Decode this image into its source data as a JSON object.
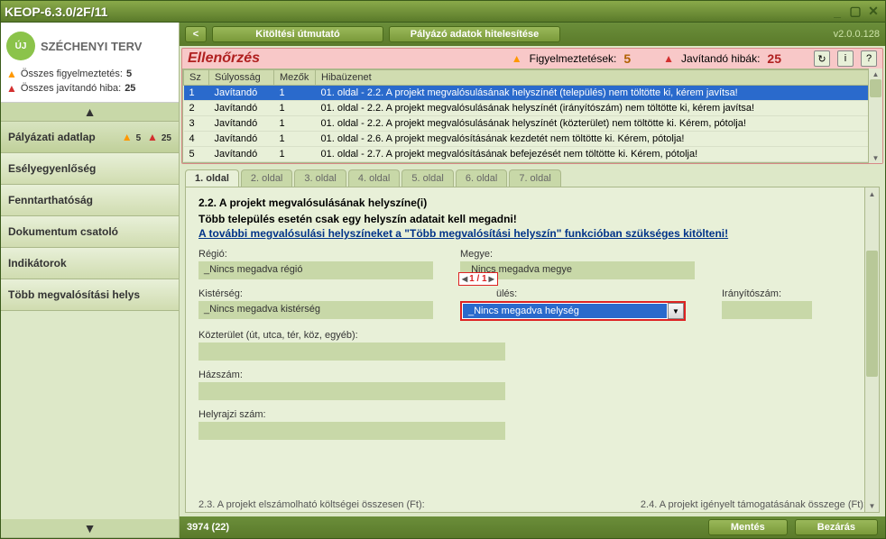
{
  "window": {
    "title": "KEOP-6.3.0/2F/11"
  },
  "logo": {
    "mark": "ÚJ",
    "text": "SZÉCHENYI TERV"
  },
  "summary": {
    "warn_label": "Összes figyelmeztetés:",
    "warn_count": "5",
    "err_label": "Összes javítandó hiba:",
    "err_count": "25"
  },
  "nav": {
    "items": [
      {
        "label": "Pályázati adatlap",
        "active": true,
        "warn": "5",
        "err": "25"
      },
      {
        "label": "Esélyegyenlőség"
      },
      {
        "label": "Fenntarthatóság"
      },
      {
        "label": "Dokumentum csatoló"
      },
      {
        "label": "Indikátorok"
      },
      {
        "label": "Több megvalósítási helys"
      }
    ],
    "tri_up": "▲",
    "tri_down": "▼"
  },
  "toolbar": {
    "back": "<",
    "btn1": "Kitöltési útmutató",
    "btn2": "Pályázó adatok hitelesítése",
    "version": "v2.0.0.128"
  },
  "errpanel": {
    "title": "Ellenőrzés",
    "warn_label": "Figyelmeztetések:",
    "warn_count": "5",
    "err_label": "Javítandó hibák:",
    "err_count": "25",
    "icons": {
      "refresh": "↻",
      "info": "i",
      "help": "?"
    },
    "headers": {
      "sz": "Sz",
      "sul": "Súlyosság",
      "mez": "Mezők",
      "hib": "Hibaüzenet"
    },
    "rows": [
      {
        "sz": "1",
        "sul": "Javítandó",
        "mez": "1",
        "hib": "01. oldal - 2.2. A projekt megvalósulásának helyszínét (település) nem töltötte ki, kérem javítsa!",
        "sel": true
      },
      {
        "sz": "2",
        "sul": "Javítandó",
        "mez": "1",
        "hib": "01. oldal - 2.2. A projekt megvalósulásának helyszínét (irányítószám) nem töltötte ki, kérem javítsa!"
      },
      {
        "sz": "3",
        "sul": "Javítandó",
        "mez": "1",
        "hib": "01. oldal - 2.2. A projekt megvalósulásának helyszínét (közterület) nem töltötte ki. Kérem, pótolja!"
      },
      {
        "sz": "4",
        "sul": "Javítandó",
        "mez": "1",
        "hib": "01. oldal - 2.6. A projekt megvalósításának kezdetét nem töltötte ki. Kérem, pótolja!"
      },
      {
        "sz": "5",
        "sul": "Javítandó",
        "mez": "1",
        "hib": "01. oldal - 2.7. A projekt megvalósításának befejezését nem töltötte ki. Kérem, pótolja!"
      }
    ]
  },
  "tabs": [
    "1. oldal",
    "2. oldal",
    "3. oldal",
    "4. oldal",
    "5. oldal",
    "6. oldal",
    "7. oldal"
  ],
  "form": {
    "heading": "2.2. A projekt megvalósulásának helyszíne(i)",
    "sub": "Több  település esetén csak egy helyszín adatait  kell megadni!",
    "link": "A további megvalósulási helyszíneket a \"Több megvalósítási helyszín\" funkcióban szükséges kitölteni!",
    "regio_label": "Régió:",
    "regio_val": "_Nincs megadva régió",
    "megye_label": "Megye:",
    "megye_val": "_Nincs megadva megye",
    "kister_label": "Kistérség:",
    "kister_val": "_Nincs megadva kistérség",
    "telep_label": "ülés:",
    "telep_val": "_Nincs megadva helység",
    "irsz_label": "Irányítószám:",
    "irsz_val": "",
    "kozter_label": "Közterület (út, utca, tér, köz, egyéb):",
    "kozter_val": "",
    "hazszam_label": "Házszám:",
    "hazszam_val": "",
    "helyrajzi_label": "Helyrajzi szám:",
    "helyrajzi_val": "",
    "pager": "1 / 1",
    "cutoff_left": "2.3. A projekt elszámolható költségei összesen (Ft):",
    "cutoff_right": "2.4. A projekt igényelt támogatásának összege (Ft):"
  },
  "footer": {
    "status": "3974 (22)",
    "save": "Mentés",
    "close": "Bezárás"
  }
}
